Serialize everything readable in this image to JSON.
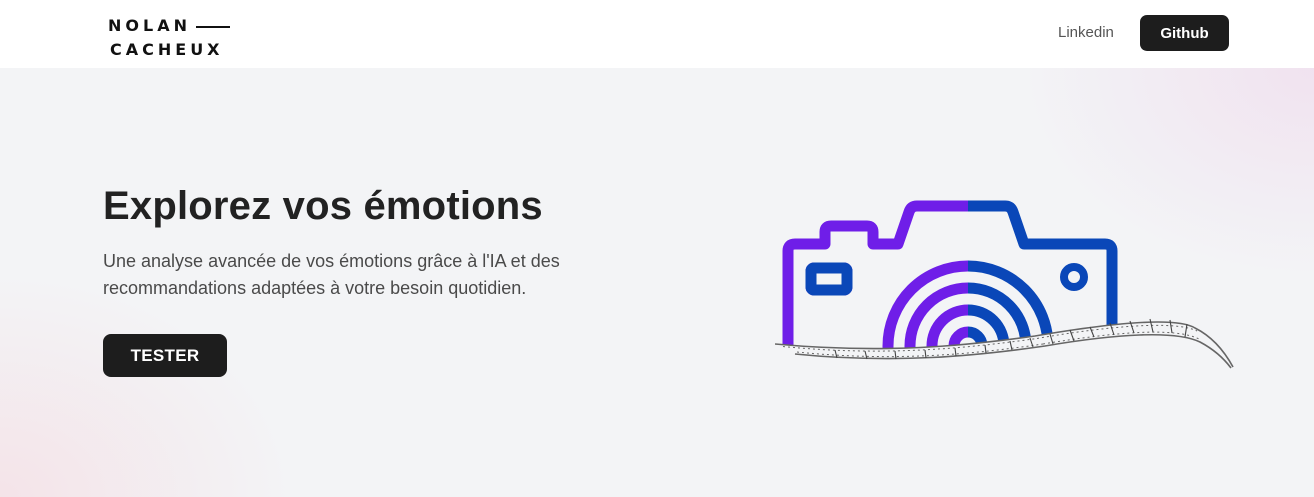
{
  "header": {
    "logo": {
      "line1": "NOLAN",
      "line2": "CACHEUX"
    },
    "nav": {
      "linkedin_label": "Linkedin",
      "github_label": "Github"
    }
  },
  "hero": {
    "title": "Explorez vos émotions",
    "description": "Une analyse avancée de vos émotions grâce à l'IA et des recommandations adaptées à votre besoin quotidien.",
    "cta_label": "TESTER",
    "illustration": {
      "icon": "camera-film-icon",
      "colors": {
        "purple": "#6f1ee8",
        "blue": "#0a47b8"
      }
    }
  },
  "colors": {
    "primary_button": "#1d1d1d",
    "hero_background": "#f3f4f6"
  }
}
